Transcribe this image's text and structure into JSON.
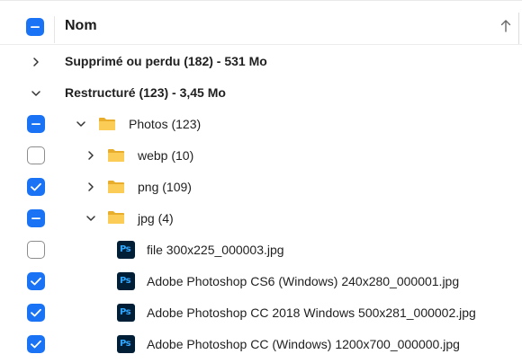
{
  "header": {
    "title": "Nom"
  },
  "rows": [
    {
      "label": "Supprimé ou perdu (182) - 531 Mo",
      "checkbox": "none",
      "expander": "collapsed",
      "icon": "none"
    },
    {
      "label": "Restructuré (123) - 3,45 Mo",
      "checkbox": "none",
      "expander": "expanded",
      "icon": "none"
    },
    {
      "label": "Photos (123)",
      "checkbox": "partial",
      "expander": "expanded",
      "icon": "folder-icon"
    },
    {
      "label": "webp (10)",
      "checkbox": "unchecked",
      "expander": "collapsed",
      "icon": "folder-icon"
    },
    {
      "label": "png (109)",
      "checkbox": "checked",
      "expander": "collapsed",
      "icon": "folder-icon"
    },
    {
      "label": "jpg (4)",
      "checkbox": "partial",
      "expander": "expanded",
      "icon": "folder-icon"
    },
    {
      "label": "file 300x225_000003.jpg",
      "checkbox": "unchecked",
      "expander": "none",
      "icon": "photoshop-file-icon"
    },
    {
      "label": "Adobe Photoshop CS6 (Windows) 240x280_000001.jpg",
      "checkbox": "checked",
      "expander": "none",
      "icon": "photoshop-file-icon"
    },
    {
      "label": "Adobe Photoshop CC 2018 Windows 500x281_000002.jpg",
      "checkbox": "checked",
      "expander": "none",
      "icon": "photoshop-file-icon"
    },
    {
      "label": "Adobe Photoshop CC (Windows) 1200x700_000000.jpg",
      "checkbox": "checked",
      "expander": "none",
      "icon": "photoshop-file-icon"
    }
  ],
  "icons": {
    "photoshop_text": "Ps"
  },
  "colors": {
    "accent": "#1a73f5",
    "folder": "#f8c84a",
    "photoshop_bg": "#001e36",
    "photoshop_fg": "#31a8ff"
  }
}
